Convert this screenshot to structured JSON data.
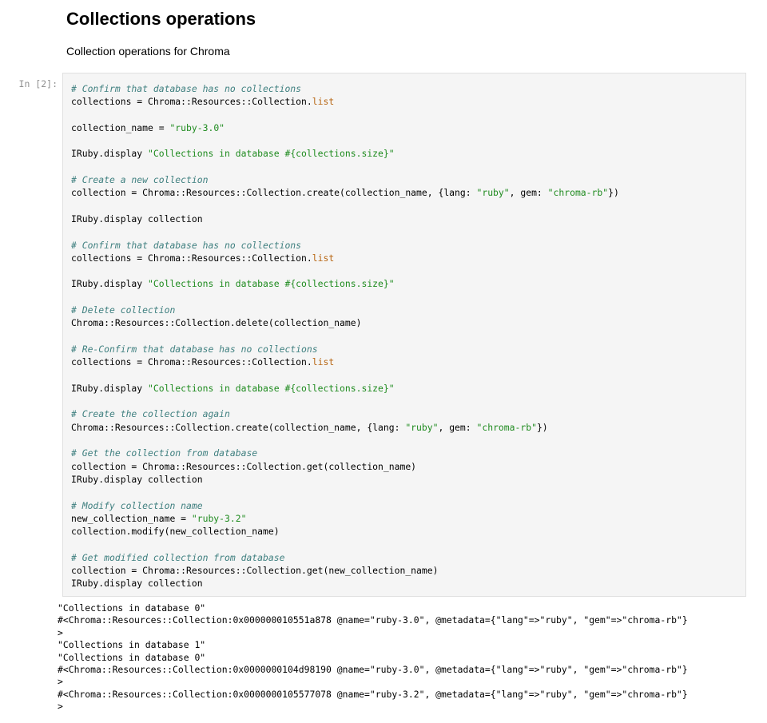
{
  "markdown": {
    "title": "Collections operations",
    "description": "Collection operations for Chroma"
  },
  "cell": {
    "prompt": "In [2]:",
    "code_lines": [
      [
        {
          "t": "# Confirm that database has no collections",
          "k": "comment"
        }
      ],
      [
        {
          "t": "collections = Chroma::Resources::Collection.",
          "k": "plain"
        },
        {
          "t": "list",
          "k": "kw"
        }
      ],
      [],
      [
        {
          "t": "collection_name = ",
          "k": "plain"
        },
        {
          "t": "\"ruby-3.0\"",
          "k": "str"
        }
      ],
      [],
      [
        {
          "t": "IRuby.display ",
          "k": "plain"
        },
        {
          "t": "\"Collections in database #{collections.size}\"",
          "k": "str"
        }
      ],
      [],
      [
        {
          "t": "# Create a new collection",
          "k": "comment"
        }
      ],
      [
        {
          "t": "collection = Chroma::Resources::Collection.create(collection_name, {lang: ",
          "k": "plain"
        },
        {
          "t": "\"ruby\"",
          "k": "str"
        },
        {
          "t": ", gem: ",
          "k": "plain"
        },
        {
          "t": "\"chroma-rb\"",
          "k": "str"
        },
        {
          "t": "})",
          "k": "plain"
        }
      ],
      [],
      [
        {
          "t": "IRuby.display collection",
          "k": "plain"
        }
      ],
      [],
      [
        {
          "t": "# Confirm that database has no collections",
          "k": "comment"
        }
      ],
      [
        {
          "t": "collections = Chroma::Resources::Collection.",
          "k": "plain"
        },
        {
          "t": "list",
          "k": "kw"
        }
      ],
      [],
      [
        {
          "t": "IRuby.display ",
          "k": "plain"
        },
        {
          "t": "\"Collections in database #{collections.size}\"",
          "k": "str"
        }
      ],
      [],
      [
        {
          "t": "# Delete collection",
          "k": "comment"
        }
      ],
      [
        {
          "t": "Chroma::Resources::Collection.delete(collection_name)",
          "k": "plain"
        }
      ],
      [],
      [
        {
          "t": "# Re-Confirm that database has no collections",
          "k": "comment"
        }
      ],
      [
        {
          "t": "collections = Chroma::Resources::Collection.",
          "k": "plain"
        },
        {
          "t": "list",
          "k": "kw"
        }
      ],
      [],
      [
        {
          "t": "IRuby.display ",
          "k": "plain"
        },
        {
          "t": "\"Collections in database #{collections.size}\"",
          "k": "str"
        }
      ],
      [],
      [
        {
          "t": "# Create the collection again",
          "k": "comment"
        }
      ],
      [
        {
          "t": "Chroma::Resources::Collection.create(collection_name, {lang: ",
          "k": "plain"
        },
        {
          "t": "\"ruby\"",
          "k": "str"
        },
        {
          "t": ", gem: ",
          "k": "plain"
        },
        {
          "t": "\"chroma-rb\"",
          "k": "str"
        },
        {
          "t": "})",
          "k": "plain"
        }
      ],
      [],
      [
        {
          "t": "# Get the collection from database",
          "k": "comment"
        }
      ],
      [
        {
          "t": "collection = Chroma::Resources::Collection.get(collection_name)",
          "k": "plain"
        }
      ],
      [
        {
          "t": "IRuby.display collection",
          "k": "plain"
        }
      ],
      [],
      [
        {
          "t": "# Modify collection name",
          "k": "comment"
        }
      ],
      [
        {
          "t": "new_collection_name = ",
          "k": "plain"
        },
        {
          "t": "\"ruby-3.2\"",
          "k": "str"
        }
      ],
      [
        {
          "t": "collection.modify(new_collection_name)",
          "k": "plain"
        }
      ],
      [],
      [
        {
          "t": "# Get modified collection from database",
          "k": "comment"
        }
      ],
      [
        {
          "t": "collection = Chroma::Resources::Collection.get(new_collection_name)",
          "k": "plain"
        }
      ],
      [
        {
          "t": "IRuby.display collection",
          "k": "plain"
        }
      ]
    ],
    "output_lines": [
      "\"Collections in database 0\"",
      "#<Chroma::Resources::Collection:0x000000010551a878 @name=\"ruby-3.0\", @metadata={\"lang\"=>\"ruby\", \"gem\"=>\"chroma-rb\"}",
      ">",
      "\"Collections in database 1\"",
      "\"Collections in database 0\"",
      "#<Chroma::Resources::Collection:0x0000000104d98190 @name=\"ruby-3.0\", @metadata={\"lang\"=>\"ruby\", \"gem\"=>\"chroma-rb\"}",
      ">",
      "#<Chroma::Resources::Collection:0x0000000105577078 @name=\"ruby-3.2\", @metadata={\"lang\"=>\"ruby\", \"gem\"=>\"chroma-rb\"}",
      ">"
    ]
  },
  "colors": {
    "comment": "#408080",
    "string": "#1f8b1f",
    "keyword": "#b86714",
    "code_background": "#f5f5f5",
    "prompt": "#909090"
  }
}
